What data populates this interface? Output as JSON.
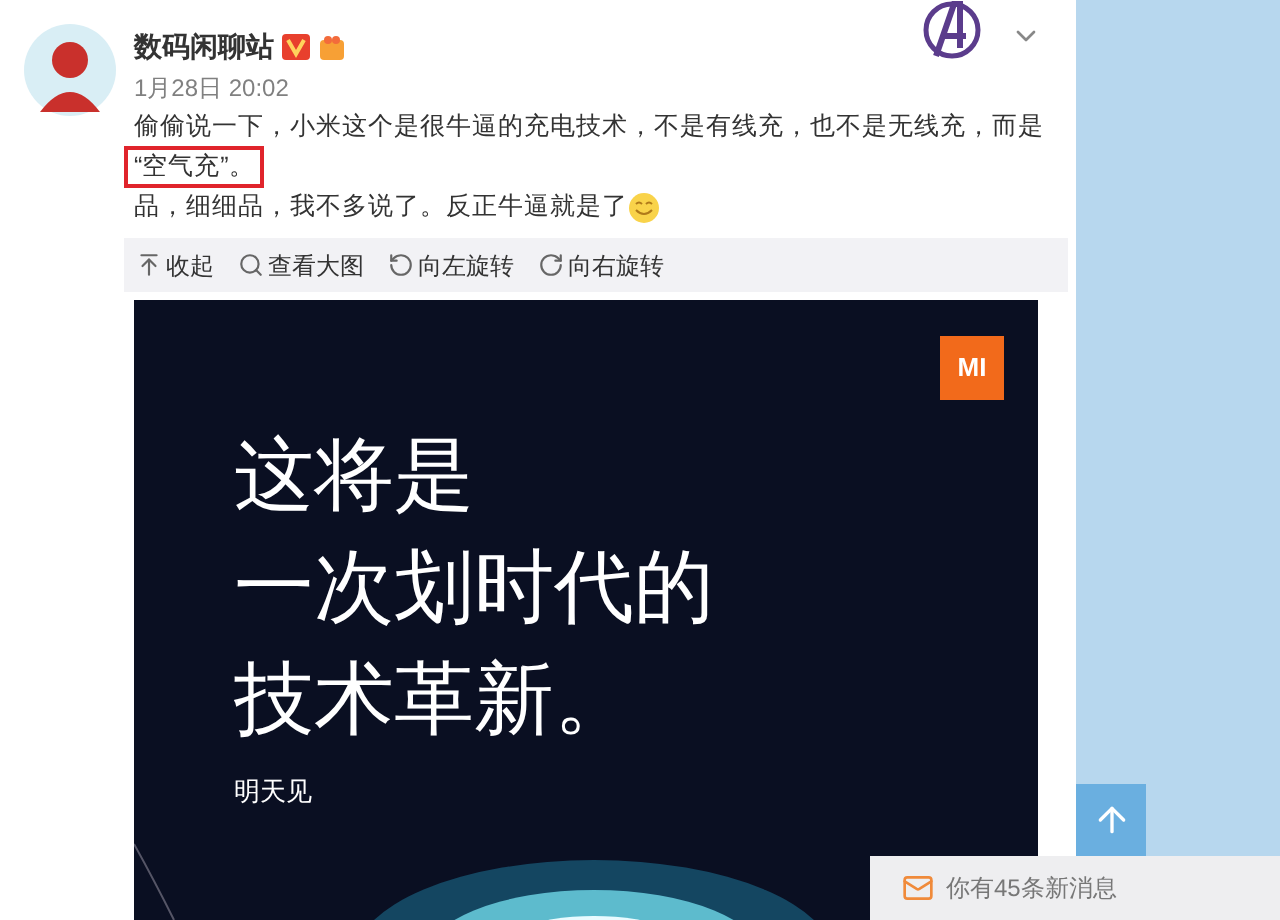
{
  "post": {
    "author": "数码闲聊站",
    "time": "1月28日 20:02",
    "text_before": "偷偷说一下，小米这个是很牛逼的充电技术，不是有线充，也不是无线充，而是",
    "text_highlight": "“空气充”。",
    "text_after": "品，细细品，我不多说了。反正牛逼就是了"
  },
  "image_toolbar": [
    {
      "label": "收起",
      "kind": "collapse"
    },
    {
      "label": "查看大图",
      "kind": "zoom"
    },
    {
      "label": "向左旋转",
      "kind": "rotate-left"
    },
    {
      "label": "向右旋转",
      "kind": "rotate-right"
    }
  ],
  "poster": {
    "logo": "MI",
    "headline": [
      "这将是",
      "一次划时代的",
      "技术革新。"
    ],
    "subline": "明天见"
  },
  "notification": {
    "text": "你有45条新消息"
  }
}
